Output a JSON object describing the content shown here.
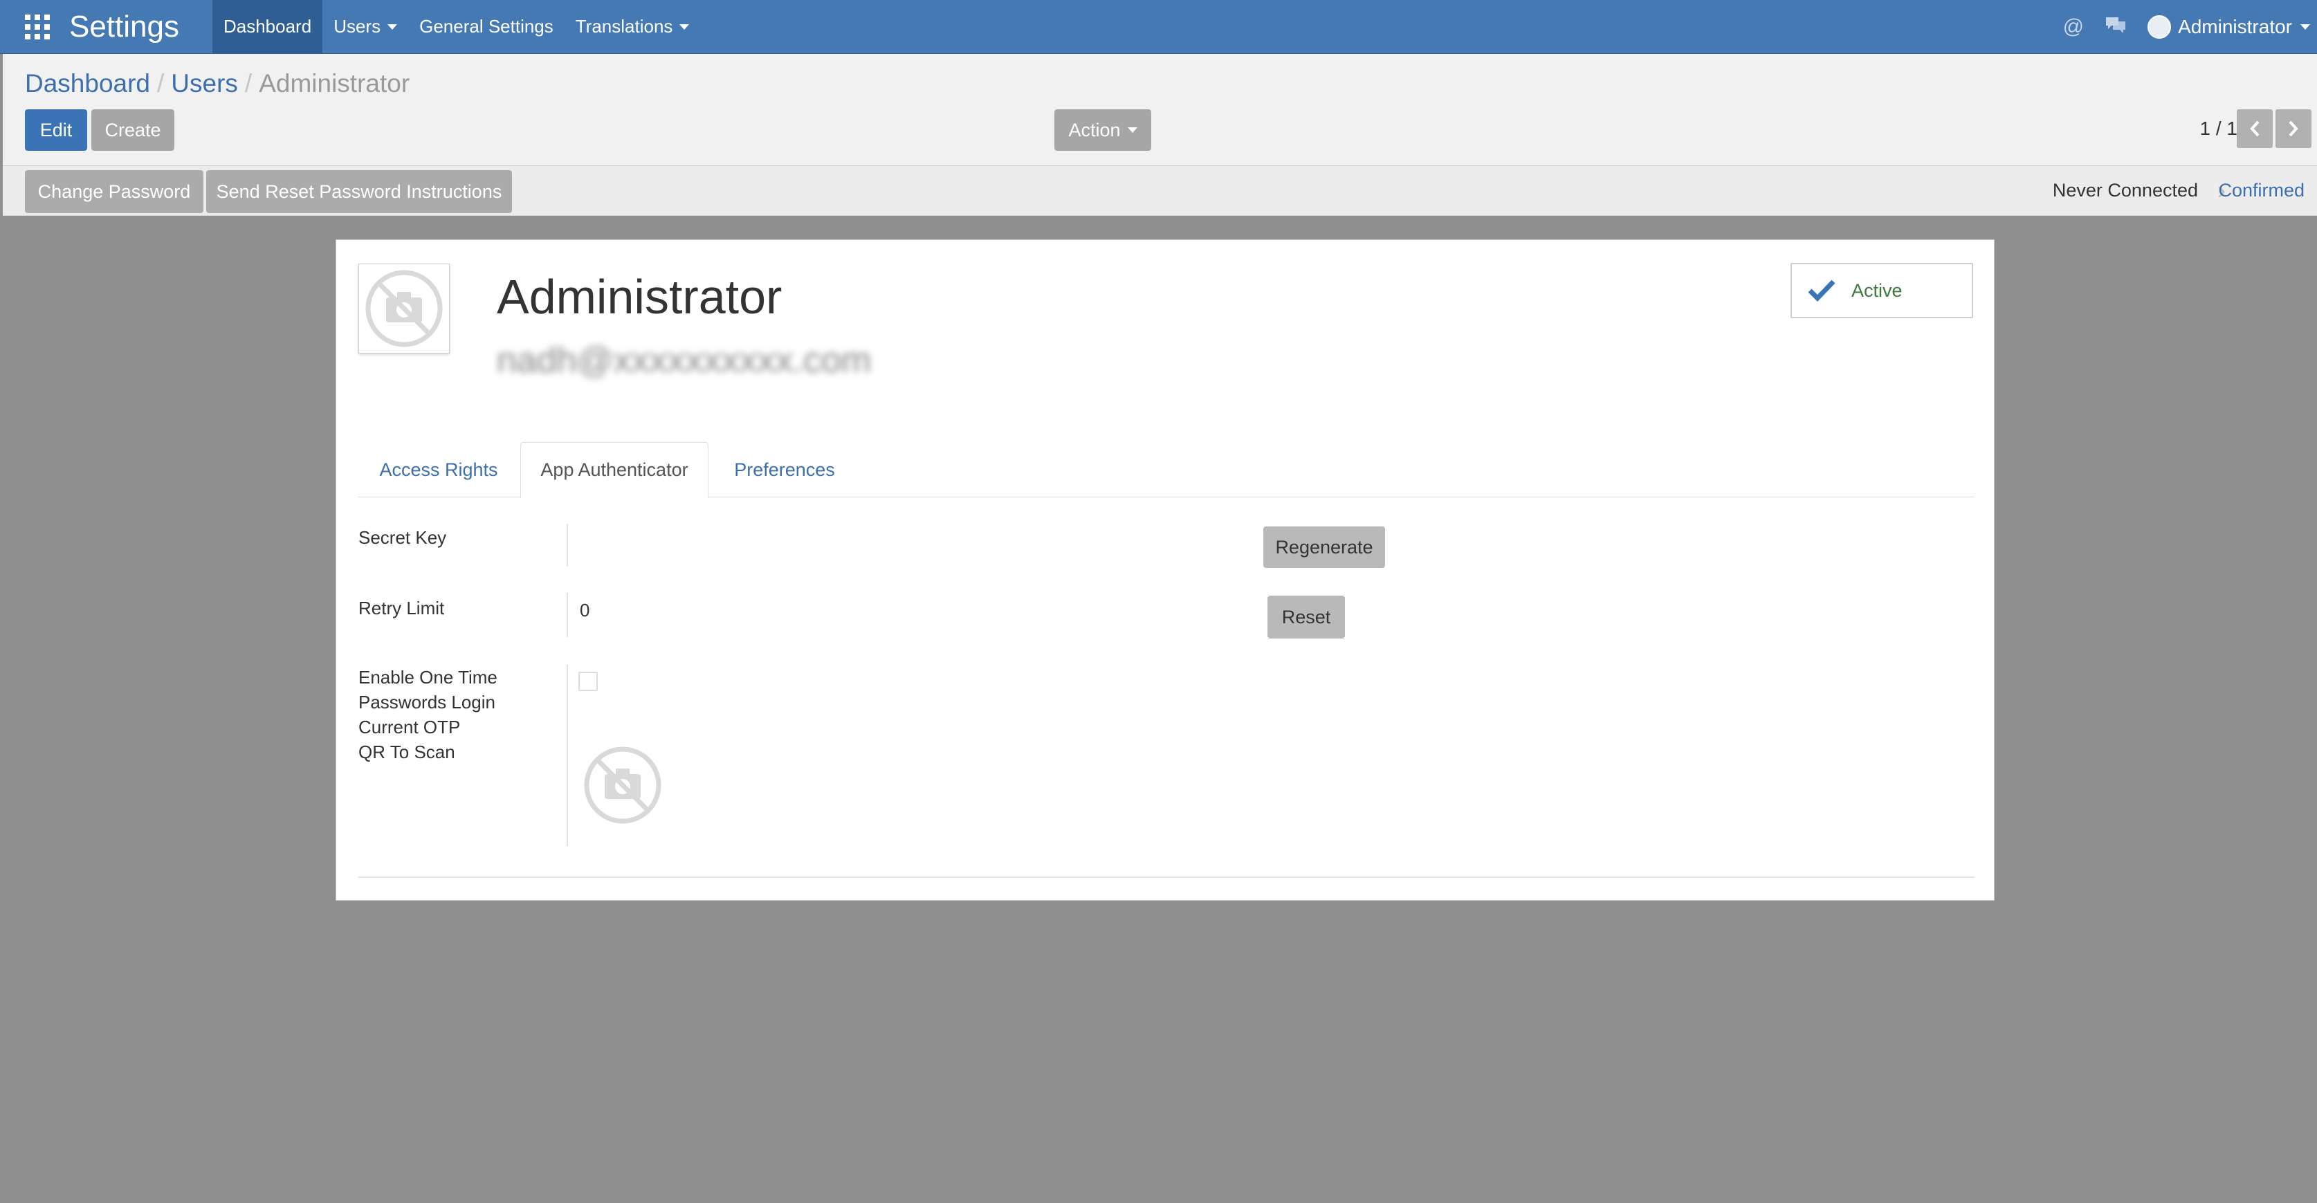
{
  "app": {
    "title": "Settings"
  },
  "nav": {
    "items": [
      {
        "label": "Dashboard",
        "active": true,
        "dropdown": false
      },
      {
        "label": "Users",
        "active": false,
        "dropdown": true
      },
      {
        "label": "General Settings",
        "active": false,
        "dropdown": false
      },
      {
        "label": "Translations",
        "active": false,
        "dropdown": true
      }
    ],
    "user": "Administrator"
  },
  "breadcrumb": {
    "items": [
      "Dashboard",
      "Users"
    ],
    "current": "Administrator",
    "separator": "/"
  },
  "toolbar": {
    "edit_label": "Edit",
    "create_label": "Create",
    "action_label": "Action"
  },
  "pager": {
    "text": "1 / 1"
  },
  "statusbar": {
    "change_password": "Change Password",
    "reset_instructions": "Send Reset Password Instructions",
    "stage_1": "Never Connected",
    "stage_2": "Confirmed"
  },
  "record": {
    "name": "Administrator",
    "email": "nadh@xxxxxxxxxx.com",
    "active_label": "Active"
  },
  "tabs": [
    {
      "label": "Access Rights",
      "active": false
    },
    {
      "label": "App Authenticator",
      "active": true
    },
    {
      "label": "Preferences",
      "active": false
    }
  ],
  "fields": {
    "secret_key": {
      "label": "Secret Key",
      "value": "",
      "button": "Regenerate"
    },
    "retry_limit": {
      "label": "Retry Limit",
      "value": "0",
      "button": "Reset"
    },
    "otp_enable": {
      "label_line1": "Enable One Time",
      "label_line2": "Passwords Login"
    },
    "current_otp": {
      "label": "Current OTP"
    },
    "qr": {
      "label": "QR To Scan"
    }
  },
  "colors": {
    "navbar": "#4479b4",
    "primary": "#3b74b6",
    "link": "#3d6fae",
    "active_green": "#3e7a3e"
  }
}
